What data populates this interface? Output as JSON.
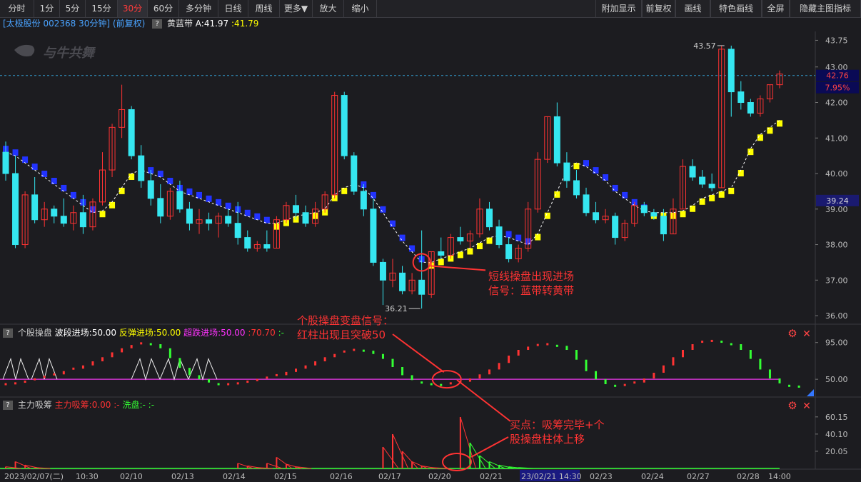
{
  "toolbar": {
    "tabs": [
      "分时",
      "1分",
      "5分",
      "15分",
      "30分",
      "60分",
      "多分钟",
      "日线",
      "周线",
      "更多▼",
      "放大",
      "缩小"
    ],
    "active_tab": "30分",
    "right_buttons": [
      "附加显示",
      "前复权",
      "画线",
      "特色画线",
      "全屏",
      "隐藏主图指标"
    ]
  },
  "stock": {
    "name_code": "[太极股份 002368 30分钟]",
    "adjust": "(前复权)",
    "indicator": "黄蓝带",
    "a_label": "A:41.97",
    "second_value": ":41.79"
  },
  "watermark": "与牛共舞",
  "main_panel": {
    "y_ticks": [
      "43.75",
      "43.00",
      "42.00",
      "41.00",
      "40.00",
      "39.00",
      "38.00",
      "37.00",
      "36.00"
    ],
    "last_price": "42.76",
    "last_pct": "7.95%",
    "level_label": "39.24",
    "high_mark": "43.57",
    "low_mark": "36.21"
  },
  "sub1": {
    "name": "个股操盘",
    "l1": "波段进场:50.00",
    "l2": "反弹进场:50.00",
    "l3": "超跌进场:50.00",
    "l4": ":70.70",
    "l5": ":-",
    "y_ticks": [
      "95.00",
      "50.00"
    ]
  },
  "sub2": {
    "name": "主力吸筹",
    "l1": "主力吸筹:0.00",
    "l2": ":-",
    "l3": "洗盘:-",
    "l4": ":-",
    "y_ticks": [
      "60.15",
      "40.10",
      "20.05"
    ]
  },
  "x_axis": [
    "2023/02/07(二)",
    "10:30",
    "02/10",
    "02/13",
    "02/14",
    "02/15",
    "02/16",
    "02/17",
    "02/20",
    "02/21",
    "23/02/21 14:30",
    "02/23",
    "02/24",
    "02/27",
    "02/28",
    "14:00"
  ],
  "annotations": {
    "main_signal": [
      "短线操盘出现进场",
      "信号：蓝带转黄带"
    ],
    "sub_signal": [
      "个股操盘变盘信号：",
      "红柱出现且突破50"
    ],
    "buy_point": [
      "买点：吸筹完毕+个",
      "股操盘柱体上移"
    ]
  },
  "colors": {
    "up": "#ff3333",
    "down": "#35e6f0",
    "yellow_band": "#ffff00",
    "blue_band": "#2233ff",
    "annotation": "#ff3333",
    "line50": "#cc33cc"
  },
  "chart_data": {
    "type": "candlestick",
    "price_ylim": [
      35.8,
      44.0
    ],
    "candles": [
      {
        "o": 40.6,
        "h": 40.9,
        "l": 39.8,
        "c": 40.0
      },
      {
        "o": 40.0,
        "h": 40.5,
        "l": 37.9,
        "c": 38.0
      },
      {
        "o": 38.0,
        "h": 39.5,
        "l": 37.9,
        "c": 39.4
      },
      {
        "o": 39.4,
        "h": 39.9,
        "l": 38.6,
        "c": 38.7
      },
      {
        "o": 38.7,
        "h": 39.2,
        "l": 38.5,
        "c": 39.0
      },
      {
        "o": 39.0,
        "h": 39.1,
        "l": 38.6,
        "c": 38.8
      },
      {
        "o": 38.8,
        "h": 39.3,
        "l": 38.5,
        "c": 38.6
      },
      {
        "o": 38.6,
        "h": 39.1,
        "l": 38.4,
        "c": 38.9
      },
      {
        "o": 38.9,
        "h": 39.4,
        "l": 38.3,
        "c": 38.5
      },
      {
        "o": 38.5,
        "h": 39.3,
        "l": 38.4,
        "c": 39.2
      },
      {
        "o": 39.2,
        "h": 40.6,
        "l": 39.1,
        "c": 40.1
      },
      {
        "o": 40.1,
        "h": 41.4,
        "l": 39.9,
        "c": 41.3
      },
      {
        "o": 41.3,
        "h": 42.5,
        "l": 41.0,
        "c": 41.8
      },
      {
        "o": 41.8,
        "h": 41.9,
        "l": 40.4,
        "c": 40.5
      },
      {
        "o": 40.5,
        "h": 40.8,
        "l": 39.6,
        "c": 39.8
      },
      {
        "o": 39.8,
        "h": 40.1,
        "l": 39.1,
        "c": 39.3
      },
      {
        "o": 39.3,
        "h": 39.7,
        "l": 38.6,
        "c": 38.8
      },
      {
        "o": 38.8,
        "h": 39.6,
        "l": 38.7,
        "c": 39.5
      },
      {
        "o": 39.5,
        "h": 39.8,
        "l": 38.9,
        "c": 39.0
      },
      {
        "o": 39.0,
        "h": 39.2,
        "l": 38.4,
        "c": 38.6
      },
      {
        "o": 38.6,
        "h": 39.0,
        "l": 38.3,
        "c": 38.7
      },
      {
        "o": 38.7,
        "h": 38.9,
        "l": 38.4,
        "c": 38.6
      },
      {
        "o": 38.6,
        "h": 38.9,
        "l": 38.2,
        "c": 38.8
      },
      {
        "o": 38.8,
        "h": 39.0,
        "l": 38.5,
        "c": 38.6
      },
      {
        "o": 38.6,
        "h": 39.2,
        "l": 38.0,
        "c": 38.2
      },
      {
        "o": 38.2,
        "h": 38.4,
        "l": 37.8,
        "c": 37.9
      },
      {
        "o": 37.9,
        "h": 38.1,
        "l": 37.8,
        "c": 38.0
      },
      {
        "o": 38.0,
        "h": 38.4,
        "l": 37.8,
        "c": 37.9
      },
      {
        "o": 37.9,
        "h": 38.8,
        "l": 37.9,
        "c": 38.7
      },
      {
        "o": 38.7,
        "h": 39.2,
        "l": 38.6,
        "c": 39.1
      },
      {
        "o": 39.1,
        "h": 39.4,
        "l": 38.7,
        "c": 38.9
      },
      {
        "o": 38.9,
        "h": 39.1,
        "l": 38.5,
        "c": 38.6
      },
      {
        "o": 38.6,
        "h": 39.2,
        "l": 38.5,
        "c": 39.0
      },
      {
        "o": 39.0,
        "h": 39.5,
        "l": 38.9,
        "c": 39.4
      },
      {
        "o": 39.4,
        "h": 42.3,
        "l": 39.3,
        "c": 42.2
      },
      {
        "o": 42.2,
        "h": 42.3,
        "l": 40.4,
        "c": 40.5
      },
      {
        "o": 40.5,
        "h": 40.6,
        "l": 39.4,
        "c": 39.5
      },
      {
        "o": 39.5,
        "h": 39.7,
        "l": 38.8,
        "c": 39.0
      },
      {
        "o": 39.0,
        "h": 39.3,
        "l": 37.4,
        "c": 37.5
      },
      {
        "o": 37.5,
        "h": 37.6,
        "l": 36.3,
        "c": 37.0
      },
      {
        "o": 37.0,
        "h": 37.6,
        "l": 36.8,
        "c": 37.2
      },
      {
        "o": 37.2,
        "h": 37.4,
        "l": 36.6,
        "c": 36.7
      },
      {
        "o": 36.7,
        "h": 37.2,
        "l": 36.6,
        "c": 37.0
      },
      {
        "o": 37.0,
        "h": 38.4,
        "l": 36.2,
        "c": 36.6
      },
      {
        "o": 36.6,
        "h": 37.8,
        "l": 36.5,
        "c": 37.8
      },
      {
        "o": 37.8,
        "h": 38.2,
        "l": 37.6,
        "c": 37.7
      },
      {
        "o": 37.7,
        "h": 38.3,
        "l": 37.6,
        "c": 38.2
      },
      {
        "o": 38.2,
        "h": 38.5,
        "l": 38.0,
        "c": 38.1
      },
      {
        "o": 38.1,
        "h": 38.4,
        "l": 37.9,
        "c": 38.3
      },
      {
        "o": 38.3,
        "h": 39.3,
        "l": 38.2,
        "c": 39.0
      },
      {
        "o": 39.0,
        "h": 39.2,
        "l": 38.4,
        "c": 38.5
      },
      {
        "o": 38.5,
        "h": 38.7,
        "l": 37.9,
        "c": 38.0
      },
      {
        "o": 38.0,
        "h": 38.2,
        "l": 37.5,
        "c": 37.6
      },
      {
        "o": 37.6,
        "h": 38.0,
        "l": 37.5,
        "c": 37.9
      },
      {
        "o": 37.9,
        "h": 39.2,
        "l": 37.8,
        "c": 39.0
      },
      {
        "o": 39.0,
        "h": 40.6,
        "l": 38.9,
        "c": 40.4
      },
      {
        "o": 40.4,
        "h": 41.6,
        "l": 40.3,
        "c": 41.6
      },
      {
        "o": 41.6,
        "h": 42.0,
        "l": 40.2,
        "c": 40.3
      },
      {
        "o": 40.3,
        "h": 40.6,
        "l": 39.6,
        "c": 39.8
      },
      {
        "o": 39.8,
        "h": 40.1,
        "l": 39.3,
        "c": 39.4
      },
      {
        "o": 39.4,
        "h": 39.6,
        "l": 38.8,
        "c": 38.9
      },
      {
        "o": 38.9,
        "h": 39.2,
        "l": 38.6,
        "c": 38.7
      },
      {
        "o": 38.7,
        "h": 39.0,
        "l": 38.6,
        "c": 38.8
      },
      {
        "o": 38.8,
        "h": 38.9,
        "l": 38.0,
        "c": 38.2
      },
      {
        "o": 38.2,
        "h": 38.7,
        "l": 38.1,
        "c": 38.6
      },
      {
        "o": 38.6,
        "h": 39.2,
        "l": 38.5,
        "c": 39.1
      },
      {
        "o": 39.1,
        "h": 39.2,
        "l": 38.8,
        "c": 38.9
      },
      {
        "o": 38.9,
        "h": 39.0,
        "l": 38.7,
        "c": 38.8
      },
      {
        "o": 38.8,
        "h": 39.0,
        "l": 38.1,
        "c": 38.3
      },
      {
        "o": 38.3,
        "h": 39.3,
        "l": 38.3,
        "c": 39.0
      },
      {
        "o": 39.0,
        "h": 40.4,
        "l": 39.0,
        "c": 40.2
      },
      {
        "o": 40.2,
        "h": 40.4,
        "l": 39.8,
        "c": 39.9
      },
      {
        "o": 39.9,
        "h": 40.1,
        "l": 39.6,
        "c": 39.7
      },
      {
        "o": 39.7,
        "h": 40.0,
        "l": 39.5,
        "c": 39.6
      },
      {
        "o": 39.6,
        "h": 43.6,
        "l": 39.6,
        "c": 43.5
      },
      {
        "o": 43.5,
        "h": 43.6,
        "l": 41.6,
        "c": 42.3
      },
      {
        "o": 42.3,
        "h": 42.6,
        "l": 41.8,
        "c": 42.0
      },
      {
        "o": 42.0,
        "h": 42.1,
        "l": 41.6,
        "c": 41.7
      },
      {
        "o": 41.7,
        "h": 42.2,
        "l": 41.6,
        "c": 42.1
      },
      {
        "o": 42.1,
        "h": 42.5,
        "l": 42.0,
        "c": 42.5
      },
      {
        "o": 42.5,
        "h": 42.9,
        "l": 42.4,
        "c": 42.8
      }
    ],
    "band": [
      40.6,
      40.5,
      40.3,
      40.1,
      39.9,
      39.7,
      39.5,
      39.3,
      39.1,
      38.9,
      38.95,
      39.2,
      39.6,
      40.0,
      40.1,
      40.0,
      39.9,
      39.7,
      39.5,
      39.4,
      39.3,
      39.2,
      39.1,
      39.0,
      38.9,
      38.8,
      38.7,
      38.6,
      38.6,
      38.7,
      38.8,
      38.85,
      38.9,
      39.0,
      39.4,
      39.6,
      39.7,
      39.6,
      39.3,
      38.9,
      38.5,
      38.1,
      37.8,
      37.5,
      37.5,
      37.6,
      37.7,
      37.8,
      37.9,
      38.05,
      38.2,
      38.25,
      38.2,
      38.1,
      38.0,
      38.3,
      38.9,
      39.5,
      40.1,
      40.3,
      40.2,
      40.0,
      39.8,
      39.5,
      39.3,
      39.1,
      38.95,
      38.9,
      38.9,
      38.9,
      38.95,
      39.1,
      39.3,
      39.4,
      39.5,
      39.6,
      40.1,
      40.7,
      41.1,
      41.3,
      41.5,
      41.7,
      41.9
    ],
    "band_dir": [
      -1,
      -1,
      -1,
      -1,
      -1,
      -1,
      -1,
      -1,
      -1,
      -1,
      1,
      1,
      1,
      1,
      1,
      -1,
      -1,
      -1,
      -1,
      -1,
      -1,
      -1,
      -1,
      -1,
      -1,
      -1,
      -1,
      -1,
      1,
      1,
      1,
      1,
      1,
      1,
      1,
      1,
      1,
      -1,
      -1,
      -1,
      -1,
      -1,
      -1,
      -1,
      1,
      1,
      1,
      1,
      1,
      1,
      1,
      -1,
      -1,
      -1,
      -1,
      1,
      1,
      1,
      1,
      1,
      -1,
      -1,
      -1,
      -1,
      -1,
      -1,
      -1,
      1,
      1,
      1,
      1,
      1,
      1,
      1,
      1,
      1,
      1,
      1,
      1,
      1,
      1,
      1,
      1
    ],
    "sub1_values": [
      44,
      45,
      47,
      50,
      53,
      56,
      60,
      63,
      67,
      72,
      77,
      83,
      88,
      92,
      94,
      93,
      88,
      76,
      64,
      55,
      50,
      46,
      44,
      44,
      45,
      47,
      49,
      52,
      55,
      59,
      63,
      67,
      72,
      77,
      81,
      84,
      86,
      85,
      81,
      75,
      65,
      55,
      49,
      46,
      44,
      43,
      45,
      47,
      51,
      56,
      62,
      70,
      79,
      86,
      90,
      92,
      93,
      91,
      86,
      74,
      60,
      50,
      44,
      42,
      43,
      46,
      51,
      58,
      67,
      77,
      86,
      93,
      96,
      97,
      96,
      93,
      86,
      75,
      62,
      51,
      45,
      42,
      41
    ],
    "sub2_values": [
      2,
      8,
      4,
      1,
      0,
      0,
      0,
      0,
      0,
      0,
      0,
      0,
      0,
      0,
      0,
      0,
      0,
      0,
      0,
      0,
      0,
      0,
      0,
      0,
      6,
      3,
      1,
      6,
      13,
      5,
      2,
      0,
      0,
      0,
      0,
      0,
      0,
      0,
      0,
      25,
      40,
      20,
      8,
      3,
      1,
      0,
      0,
      60,
      30,
      15,
      8,
      4,
      2,
      1,
      0,
      0,
      0,
      0,
      0,
      0,
      0,
      0,
      0,
      0,
      0,
      0,
      0,
      0,
      0,
      0,
      0,
      0,
      0,
      0,
      0,
      0,
      0,
      0,
      0,
      0,
      0,
      0,
      0
    ]
  }
}
